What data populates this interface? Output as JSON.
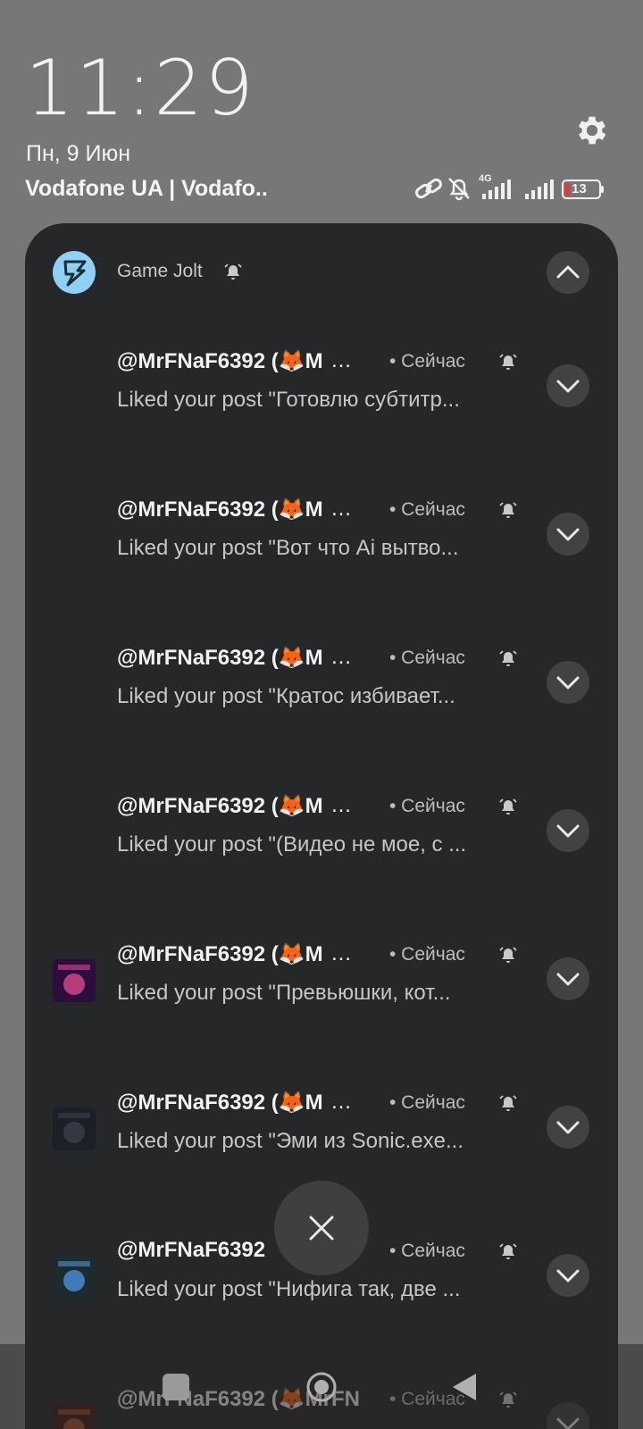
{
  "status": {
    "time": "11:29",
    "date": "Пн, 9 Июн",
    "carrier": "Vodafone UA | Vodafo..",
    "network_type": "4G",
    "battery_level": "13",
    "icons": [
      "link-icon",
      "bell-off-icon",
      "signal-4g-icon",
      "signal-icon",
      "battery-icon"
    ],
    "settings_icon": "gear-icon"
  },
  "app": {
    "name": "Game Jolt",
    "icon": "game-jolt-icon",
    "accent_color": "#8fd1f4"
  },
  "notifications": [
    {
      "title": "@MrFNaF6392 (🦊M",
      "ellipsis": "…",
      "time": "• Сейчас",
      "body": "Liked your post \"Готовлю субтитр...",
      "thumb": "none"
    },
    {
      "title": "@MrFNaF6392 (🦊M",
      "ellipsis": "…",
      "time": "• Сейчас",
      "body": "Liked your post \"Вот что Ai вытво...",
      "thumb": "none"
    },
    {
      "title": "@MrFNaF6392 (🦊M",
      "ellipsis": "…",
      "time": "• Сейчас",
      "body": "Liked your post \"Кратос избивает...",
      "thumb": "none"
    },
    {
      "title": "@MrFNaF6392 (🦊M",
      "ellipsis": "…",
      "time": "• Сейчас",
      "body": "Liked your post \"(Видео не мое, с ...",
      "thumb": "none"
    },
    {
      "title": "@MrFNaF6392 (🦊M",
      "ellipsis": "…",
      "time": "• Сейчас",
      "body": "Liked your post \"Превьюшки, кот...",
      "thumb": "purple"
    },
    {
      "title": "@MrFNaF6392 (🦊M",
      "ellipsis": "…",
      "time": "• Сейчас",
      "body": "Liked your post \"Эми из Sonic.exe...",
      "thumb": "dark"
    },
    {
      "title": "@MrFNaF6392",
      "ellipsis": "…",
      "time": "• Сейчас",
      "body": "Liked your post \"Нифига так, две ...",
      "thumb": "teal"
    },
    {
      "title": "@MrFNaF6392 (🦊MrFN",
      "ellipsis": "",
      "time": "• Сейчас",
      "body": "",
      "thumb": "orange"
    }
  ],
  "buttons": {
    "close": "×"
  }
}
